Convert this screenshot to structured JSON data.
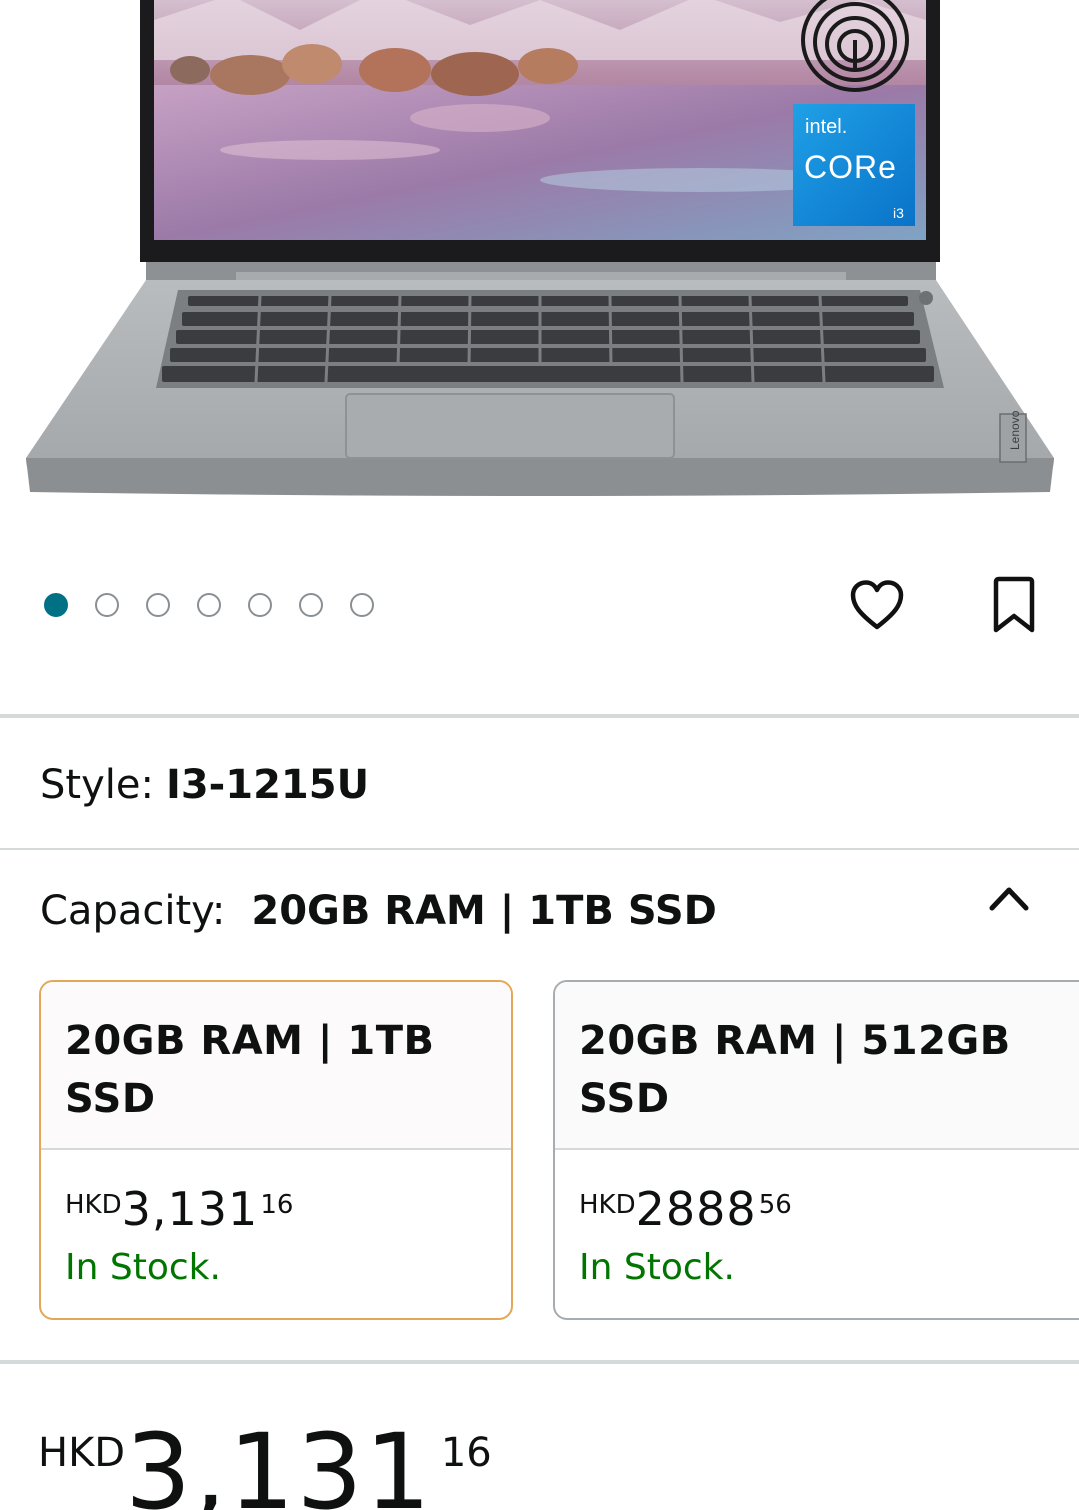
{
  "product_image": {
    "brand_badge": "intel.",
    "badge_line": "CORe",
    "badge_tier": "i3",
    "lid_logo": "Lenovo"
  },
  "carousel": {
    "total": 7,
    "active_index": 0
  },
  "actions": {
    "like_icon": "heart-icon",
    "save_icon": "bookmark-icon"
  },
  "style": {
    "label": "Style:",
    "value": "I3-1215U"
  },
  "capacity": {
    "label": "Capacity:",
    "value": "20GB RAM | 1TB SSD",
    "toggle_icon": "chevron-up-icon",
    "options": [
      {
        "title": "20GB RAM | 1TB SSD",
        "currency": "HKD",
        "price_whole": "3,131",
        "price_fraction": "16",
        "availability": "In Stock.",
        "selected": true
      },
      {
        "title": "20GB RAM | 512GB SSD",
        "currency": "HKD",
        "price_whole": "2888",
        "price_fraction": "56",
        "availability": "In Stock.",
        "selected": false
      }
    ]
  },
  "price": {
    "currency": "HKD",
    "whole": "3,131",
    "fraction": "16"
  },
  "colors": {
    "accent_teal": "#007185",
    "selected_border": "#e3a857",
    "in_stock": "#007600",
    "divider": "#d5d9d9"
  }
}
